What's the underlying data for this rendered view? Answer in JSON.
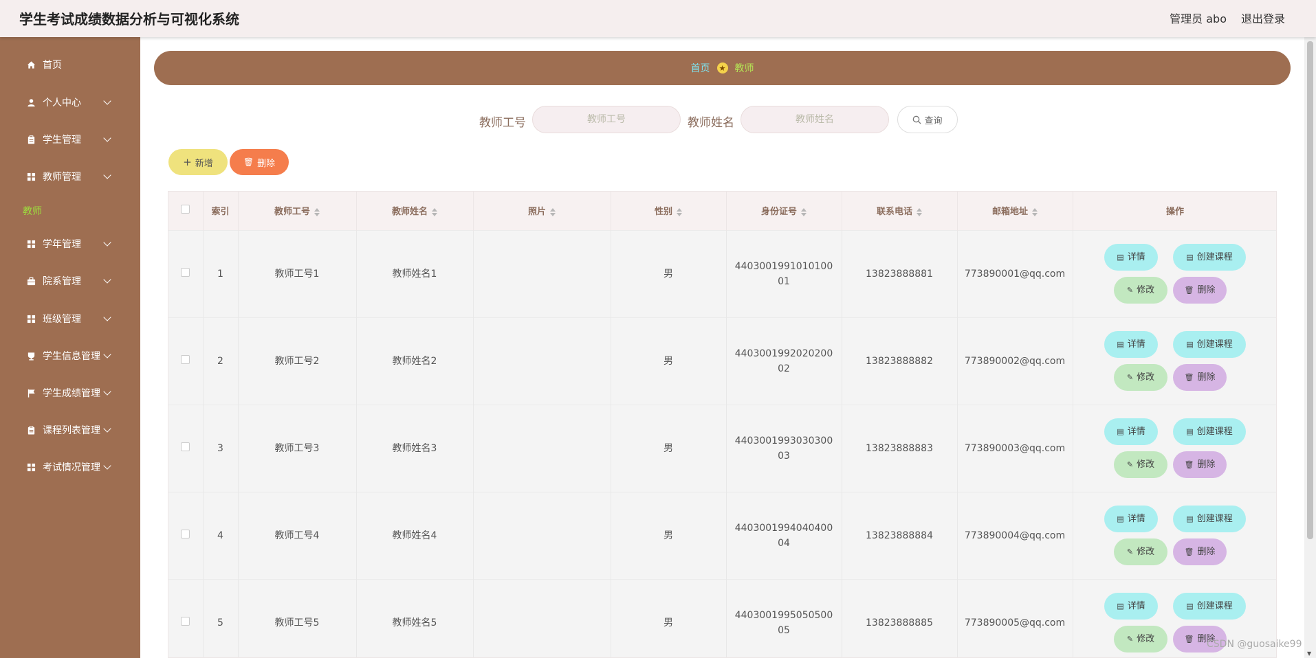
{
  "header": {
    "title": "学生考试成绩数据分析与可视化系统",
    "user": "管理员 abo",
    "logout": "退出登录"
  },
  "sidebar": {
    "items": [
      {
        "label": "首页",
        "icon": "home-icon",
        "chevron": false
      },
      {
        "label": "个人中心",
        "icon": "user-icon",
        "chevron": true
      },
      {
        "label": "学生管理",
        "icon": "clipboard-icon",
        "chevron": true
      },
      {
        "label": "教师管理",
        "icon": "grid-icon",
        "chevron": true
      },
      {
        "label": "学年管理",
        "icon": "grid-icon",
        "chevron": true
      },
      {
        "label": "院系管理",
        "icon": "briefcase-icon",
        "chevron": true
      },
      {
        "label": "班级管理",
        "icon": "grid-icon",
        "chevron": true
      },
      {
        "label": "学生信息管理",
        "icon": "cup-icon",
        "chevron": true
      },
      {
        "label": "学生成绩管理",
        "icon": "flag-icon",
        "chevron": true
      },
      {
        "label": "课程列表管理",
        "icon": "clipboard-icon",
        "chevron": true
      },
      {
        "label": "考试情况管理",
        "icon": "grid-icon",
        "chevron": true
      }
    ],
    "sub_item": "教师"
  },
  "breadcrumb": {
    "home": "首页",
    "current": "教师"
  },
  "search": {
    "field1_label": "教师工号",
    "field1_placeholder": "教师工号",
    "field2_label": "教师姓名",
    "field2_placeholder": "教师姓名",
    "button": "查询"
  },
  "actions": {
    "add": "新增",
    "delete": "删除"
  },
  "table": {
    "columns": [
      "索引",
      "教师工号",
      "教师姓名",
      "照片",
      "性别",
      "身份证号",
      "联系电话",
      "邮箱地址",
      "操作"
    ],
    "rows": [
      {
        "index": "1",
        "id": "教师工号1",
        "name": "教师姓名1",
        "gender": "男",
        "idcard": "440300199101010001",
        "phone": "13823888881",
        "email": "773890001@qq.com"
      },
      {
        "index": "2",
        "id": "教师工号2",
        "name": "教师姓名2",
        "gender": "男",
        "idcard": "440300199202020002",
        "phone": "13823888882",
        "email": "773890002@qq.com"
      },
      {
        "index": "3",
        "id": "教师工号3",
        "name": "教师姓名3",
        "gender": "男",
        "idcard": "440300199303030003",
        "phone": "13823888883",
        "email": "773890003@qq.com"
      },
      {
        "index": "4",
        "id": "教师工号4",
        "name": "教师姓名4",
        "gender": "男",
        "idcard": "440300199404040004",
        "phone": "13823888884",
        "email": "773890004@qq.com"
      },
      {
        "index": "5",
        "id": "教师工号5",
        "name": "教师姓名5",
        "gender": "男",
        "idcard": "440300199505050005",
        "phone": "13823888885",
        "email": "773890005@qq.com"
      }
    ],
    "row_actions": {
      "detail": "详情",
      "create_course": "创建课程",
      "edit": "修改",
      "delete": "删除"
    }
  },
  "watermark": "CSDN @guosaike99",
  "colors": {
    "sidebar": "#9e6e51",
    "header": "#f5eeee",
    "accent_green": "#9ddc3e",
    "btn_detail": "#a9eff0",
    "btn_edit": "#c2e8c0",
    "btn_delete": "#d6b5e4",
    "btn_add": "#efe27d",
    "btn_batch_delete": "#f57d4c"
  }
}
